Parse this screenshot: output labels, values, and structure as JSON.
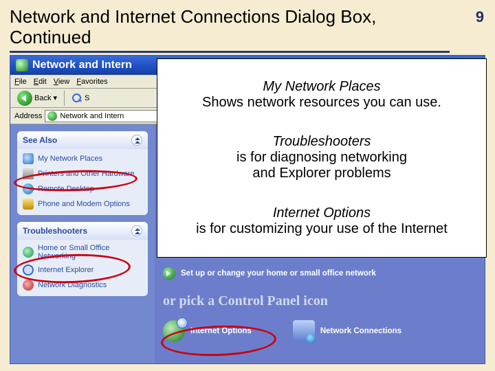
{
  "page_number": "9",
  "slide_title": "Network and Internet Connections Dialog Box, Continued",
  "xp": {
    "title": "Network and Intern",
    "menu": {
      "file": "File",
      "edit": "Edit",
      "view": "View",
      "favorites": "Favorites"
    },
    "toolbar": {
      "back": "Back",
      "search_partial": "S"
    },
    "address": {
      "label": "Address",
      "value": "Network and Intern"
    },
    "sidebar": {
      "see_also": {
        "title": "See Also",
        "items": [
          "My Network Places",
          "Printers and Other Hardware",
          "Remote Desktop",
          "Phone and Modem Options"
        ]
      },
      "troubleshooters": {
        "title": "Troubleshooters",
        "items": [
          "Home or Small Office Networking",
          "Internet Explorer",
          "Network Diagnostics"
        ]
      }
    },
    "content": {
      "task": "Set up or change your home or small office network",
      "pick": "or pick a Control Panel icon",
      "icons": {
        "internet_options": "Internet Options",
        "network_connections": "Network Connections"
      }
    }
  },
  "overlay": {
    "b1_title": "My Network Places",
    "b1_text": "Shows network resources you can use.",
    "b2_title": "Troubleshooters",
    "b2_text1": "is for diagnosing networking",
    "b2_text2": "and Explorer problems",
    "b3_title": "Internet Options",
    "b3_text": "is for customizing your use of the Internet"
  }
}
